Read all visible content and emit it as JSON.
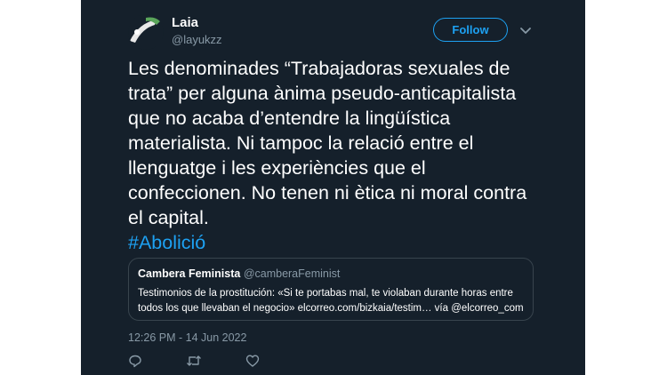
{
  "author": {
    "name": "Laia",
    "handle": "@layukzz"
  },
  "follow_button": "Follow",
  "tweet": {
    "text": "Les denominades “Trabajadoras sexuales de trata” per alguna ànima pseudo-anticapitalista que no acaba d’entendre la lingüística materialista. Ni tampoc la relació entre el llenguatge i les experiències que el confeccionen. No tenen ni ètica ni moral contra el capital.",
    "hashtag": "#Abolició"
  },
  "quote": {
    "name": "Cambera Feminista",
    "handle": "@camberaFeminist",
    "text": "Testimonios de la prostitución: «Si te portabas mal, te violaban durante horas entre todos los que llevaban el negocio» elcorreo.com/bizkaia/testim… vía @elcorreo_com"
  },
  "timestamp": "12:26 PM - 14 Jun 2022",
  "icons": [
    "reply-icon",
    "retweet-icon",
    "like-icon",
    "chevron-down-icon"
  ],
  "colors": {
    "background": "#15202b",
    "accent": "#1da1f2",
    "secondary_text": "#8899a6",
    "border": "#38444d"
  }
}
